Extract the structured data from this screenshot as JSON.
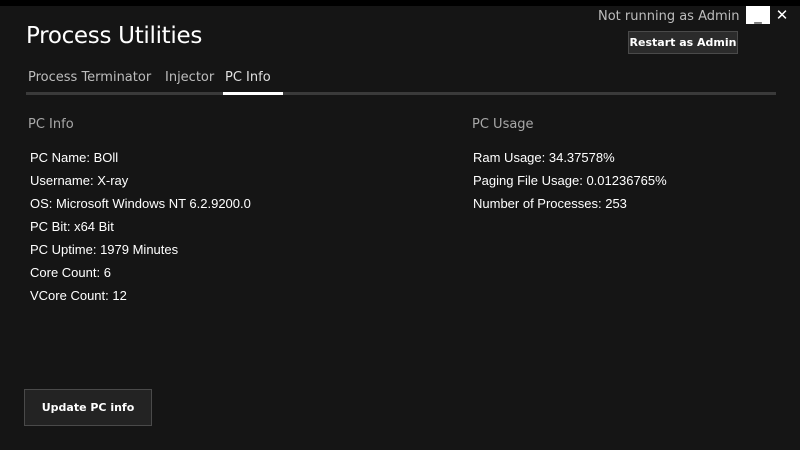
{
  "window": {
    "title": "Process Utilities",
    "admin_status": "Not running as Admin",
    "minimize_glyph": "_",
    "close_glyph": "✕",
    "restart_label": "Restart as Admin"
  },
  "tabs": [
    {
      "label": "Process Terminator",
      "active": false
    },
    {
      "label": "Injector",
      "active": false
    },
    {
      "label": "PC Info",
      "active": true
    }
  ],
  "pc_info": {
    "title": "PC Info",
    "items": [
      "PC Name: BOll",
      "Username: X-ray",
      "OS: Microsoft Windows NT 6.2.9200.0",
      "PC Bit: x64 Bit",
      "PC Uptime: 1979 Minutes",
      "Core Count: 6",
      "VCore Count: 12"
    ]
  },
  "pc_usage": {
    "title": "PC Usage",
    "items": [
      "Ram Usage: 34.37578%",
      "Paging File Usage: 0.01236765%",
      "Number of Processes: 253"
    ]
  },
  "actions": {
    "update_label": "Update PC info"
  },
  "colors": {
    "background": "#151515",
    "text": "#ffffff",
    "muted": "#a8a8a8",
    "accent": "#ffffff"
  }
}
